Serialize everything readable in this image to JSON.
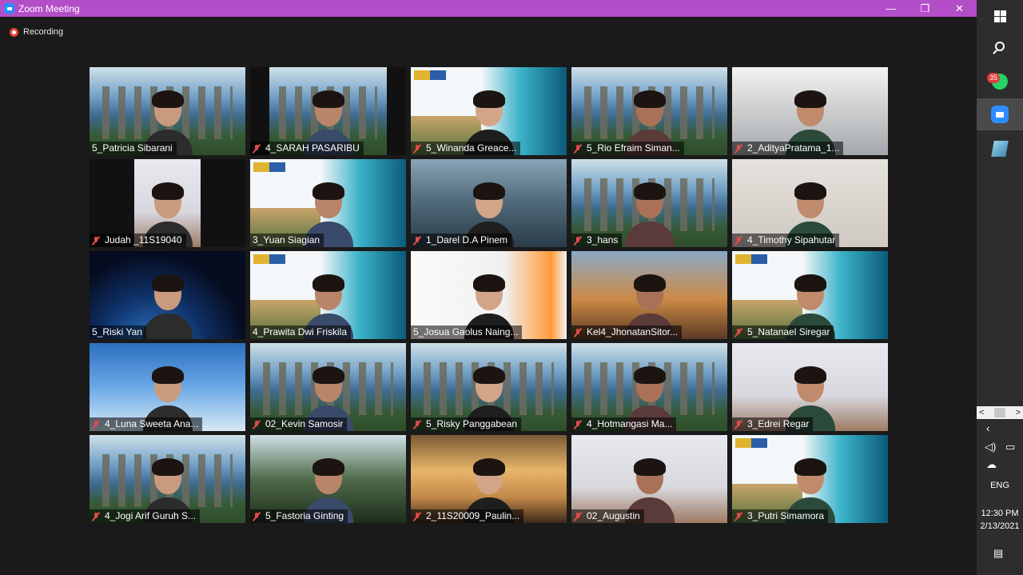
{
  "window": {
    "title": "Zoom Meeting",
    "controls": {
      "minimize": "—",
      "restore": "❐",
      "close": "✕"
    }
  },
  "recording": {
    "label": "Recording"
  },
  "tiles": [
    {
      "name": "5_Patricia Sibarani",
      "muted": false,
      "bg": "campus",
      "active": false
    },
    {
      "name": "4_SARAH PASARIBU",
      "muted": true,
      "bg": "campus",
      "active": false
    },
    {
      "name": "5_Winanda Greace...",
      "muted": true,
      "bg": "slide",
      "active": false
    },
    {
      "name": "5_Rio Efraim Siman...",
      "muted": true,
      "bg": "campus",
      "active": false
    },
    {
      "name": "2_AdityaPratama_1...",
      "muted": true,
      "bg": "building",
      "active": false
    },
    {
      "name": "Judah _11S19040",
      "muted": true,
      "bg": "black",
      "active": false
    },
    {
      "name": "3_Yuan Siagian",
      "muted": false,
      "bg": "slide",
      "active": false
    },
    {
      "name": "1_Darel D.A Pinem",
      "muted": true,
      "bg": "ship",
      "active": false
    },
    {
      "name": "3_hans",
      "muted": true,
      "bg": "campus",
      "active": false
    },
    {
      "name": "4_Timothy Sipahutar",
      "muted": true,
      "bg": "pale",
      "active": false
    },
    {
      "name": "5_Riski Yan",
      "muted": false,
      "bg": "space",
      "active": false
    },
    {
      "name": "4_Prawita Dwi Friskila",
      "muted": false,
      "bg": "slide",
      "active": true
    },
    {
      "name": "5_Josua Gaolus Naing...",
      "muted": false,
      "bg": "paper",
      "active": false
    },
    {
      "name": "Kel4_JhonatanSitor...",
      "muted": true,
      "bg": "war",
      "active": false
    },
    {
      "name": "5_Natanael Siregar",
      "muted": true,
      "bg": "slide",
      "active": false
    },
    {
      "name": "4_Luna Sweeta Ana...",
      "muted": true,
      "bg": "sky",
      "active": false
    },
    {
      "name": "02_Kevin Samosir",
      "muted": true,
      "bg": "campus",
      "active": false
    },
    {
      "name": "5_Risky Panggabean",
      "muted": true,
      "bg": "campus",
      "active": false
    },
    {
      "name": "4_Hotmangasi Ma...",
      "muted": true,
      "bg": "campus",
      "active": false
    },
    {
      "name": "3_Edrei Regar",
      "muted": true,
      "bg": "room",
      "active": false
    },
    {
      "name": "4_Jogi Arif Guruh S...",
      "muted": true,
      "bg": "campus",
      "active": false
    },
    {
      "name": "5_Fastoria Ginting",
      "muted": true,
      "bg": "trees",
      "active": false
    },
    {
      "name": "2_11S20009_Paulin...",
      "muted": true,
      "bg": "window",
      "active": false
    },
    {
      "name": "02_Augustin",
      "muted": true,
      "bg": "room",
      "active": false
    },
    {
      "name": "3_Putri Simamora",
      "muted": true,
      "bg": "slide",
      "active": false
    }
  ],
  "taskbar": {
    "whatsapp_badge": "35",
    "scroll_left": "<",
    "scroll_right": ">",
    "tray_chevron": "‹",
    "language": "ENG",
    "time": "12:30 PM",
    "date": "2/13/2021"
  },
  "colors": {
    "titlebar": "#b34ec9",
    "active_speaker": "#e7e27a",
    "muted_mic": "#e24b4b"
  }
}
